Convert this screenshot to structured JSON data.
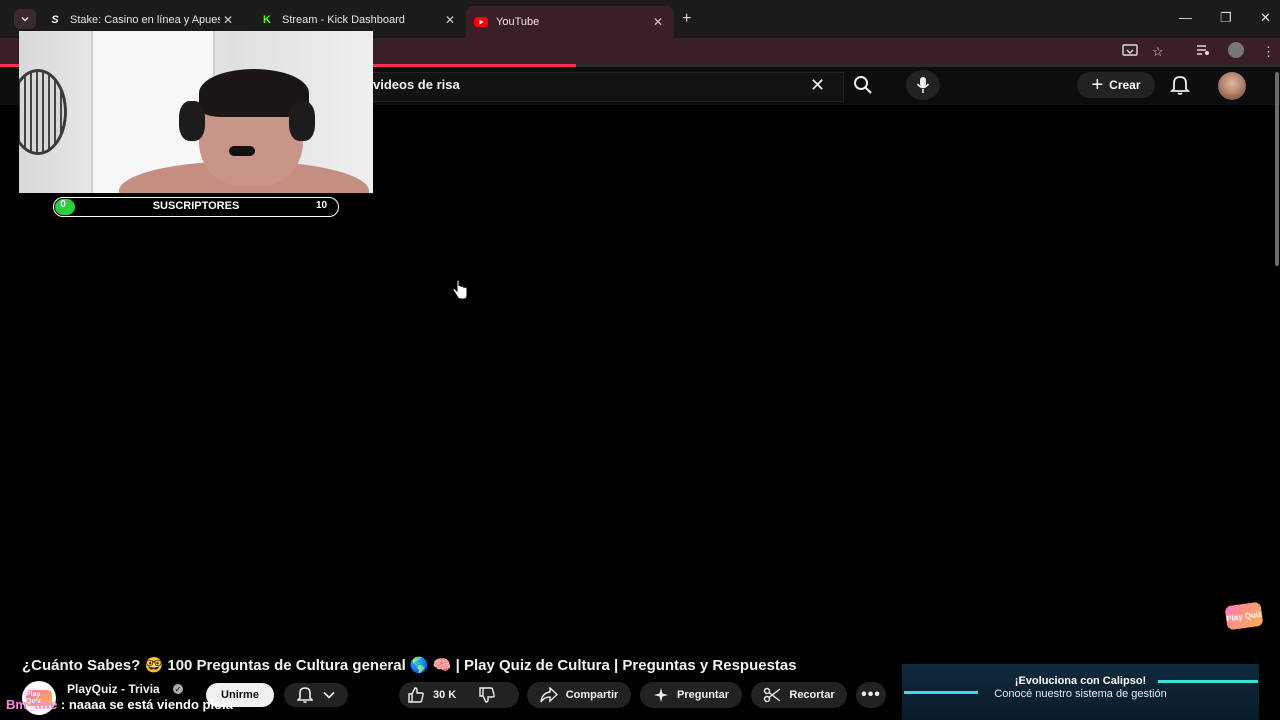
{
  "browser": {
    "tabs": [
      {
        "label": "Stake: Casino en línea y Apuestas",
        "favicon": "S",
        "active": false
      },
      {
        "label": "Stream - Kick Dashboard",
        "favicon": "K",
        "active": false
      },
      {
        "label": "YouTube",
        "favicon": "youtube-icon",
        "active": true
      }
    ],
    "page_load_progress": 0.45
  },
  "header": {
    "search_query": "videos de risa",
    "create_label": "Crear"
  },
  "overlay": {
    "subs_current": "0",
    "subs_label": "SUSCRIPTORES",
    "subs_goal": "10",
    "subs_progress": 0.0,
    "accent_color": "#2ecc40"
  },
  "video": {
    "title": "¿Cuánto Sabes? 🤓 100 Preguntas de Cultura general 🌎 🧠 | Play Quiz de Cultura | Preguntas y Respuestas",
    "channel_name": "PlayQuiz - Trivia",
    "join_label": "Unirme",
    "like_count": "30 K",
    "share_label": "Compartir",
    "ask_label": "Preguntar",
    "clip_label": "Recortar"
  },
  "chat": {
    "username": "Bm_tate",
    "message": " : naaaa se está viendo piola"
  },
  "ad": {
    "title": "¡Evoluciona con Calipso!",
    "subtitle": "Conocé nuestro sistema de gestión"
  },
  "watermark": {
    "text": "Play Quiz"
  }
}
